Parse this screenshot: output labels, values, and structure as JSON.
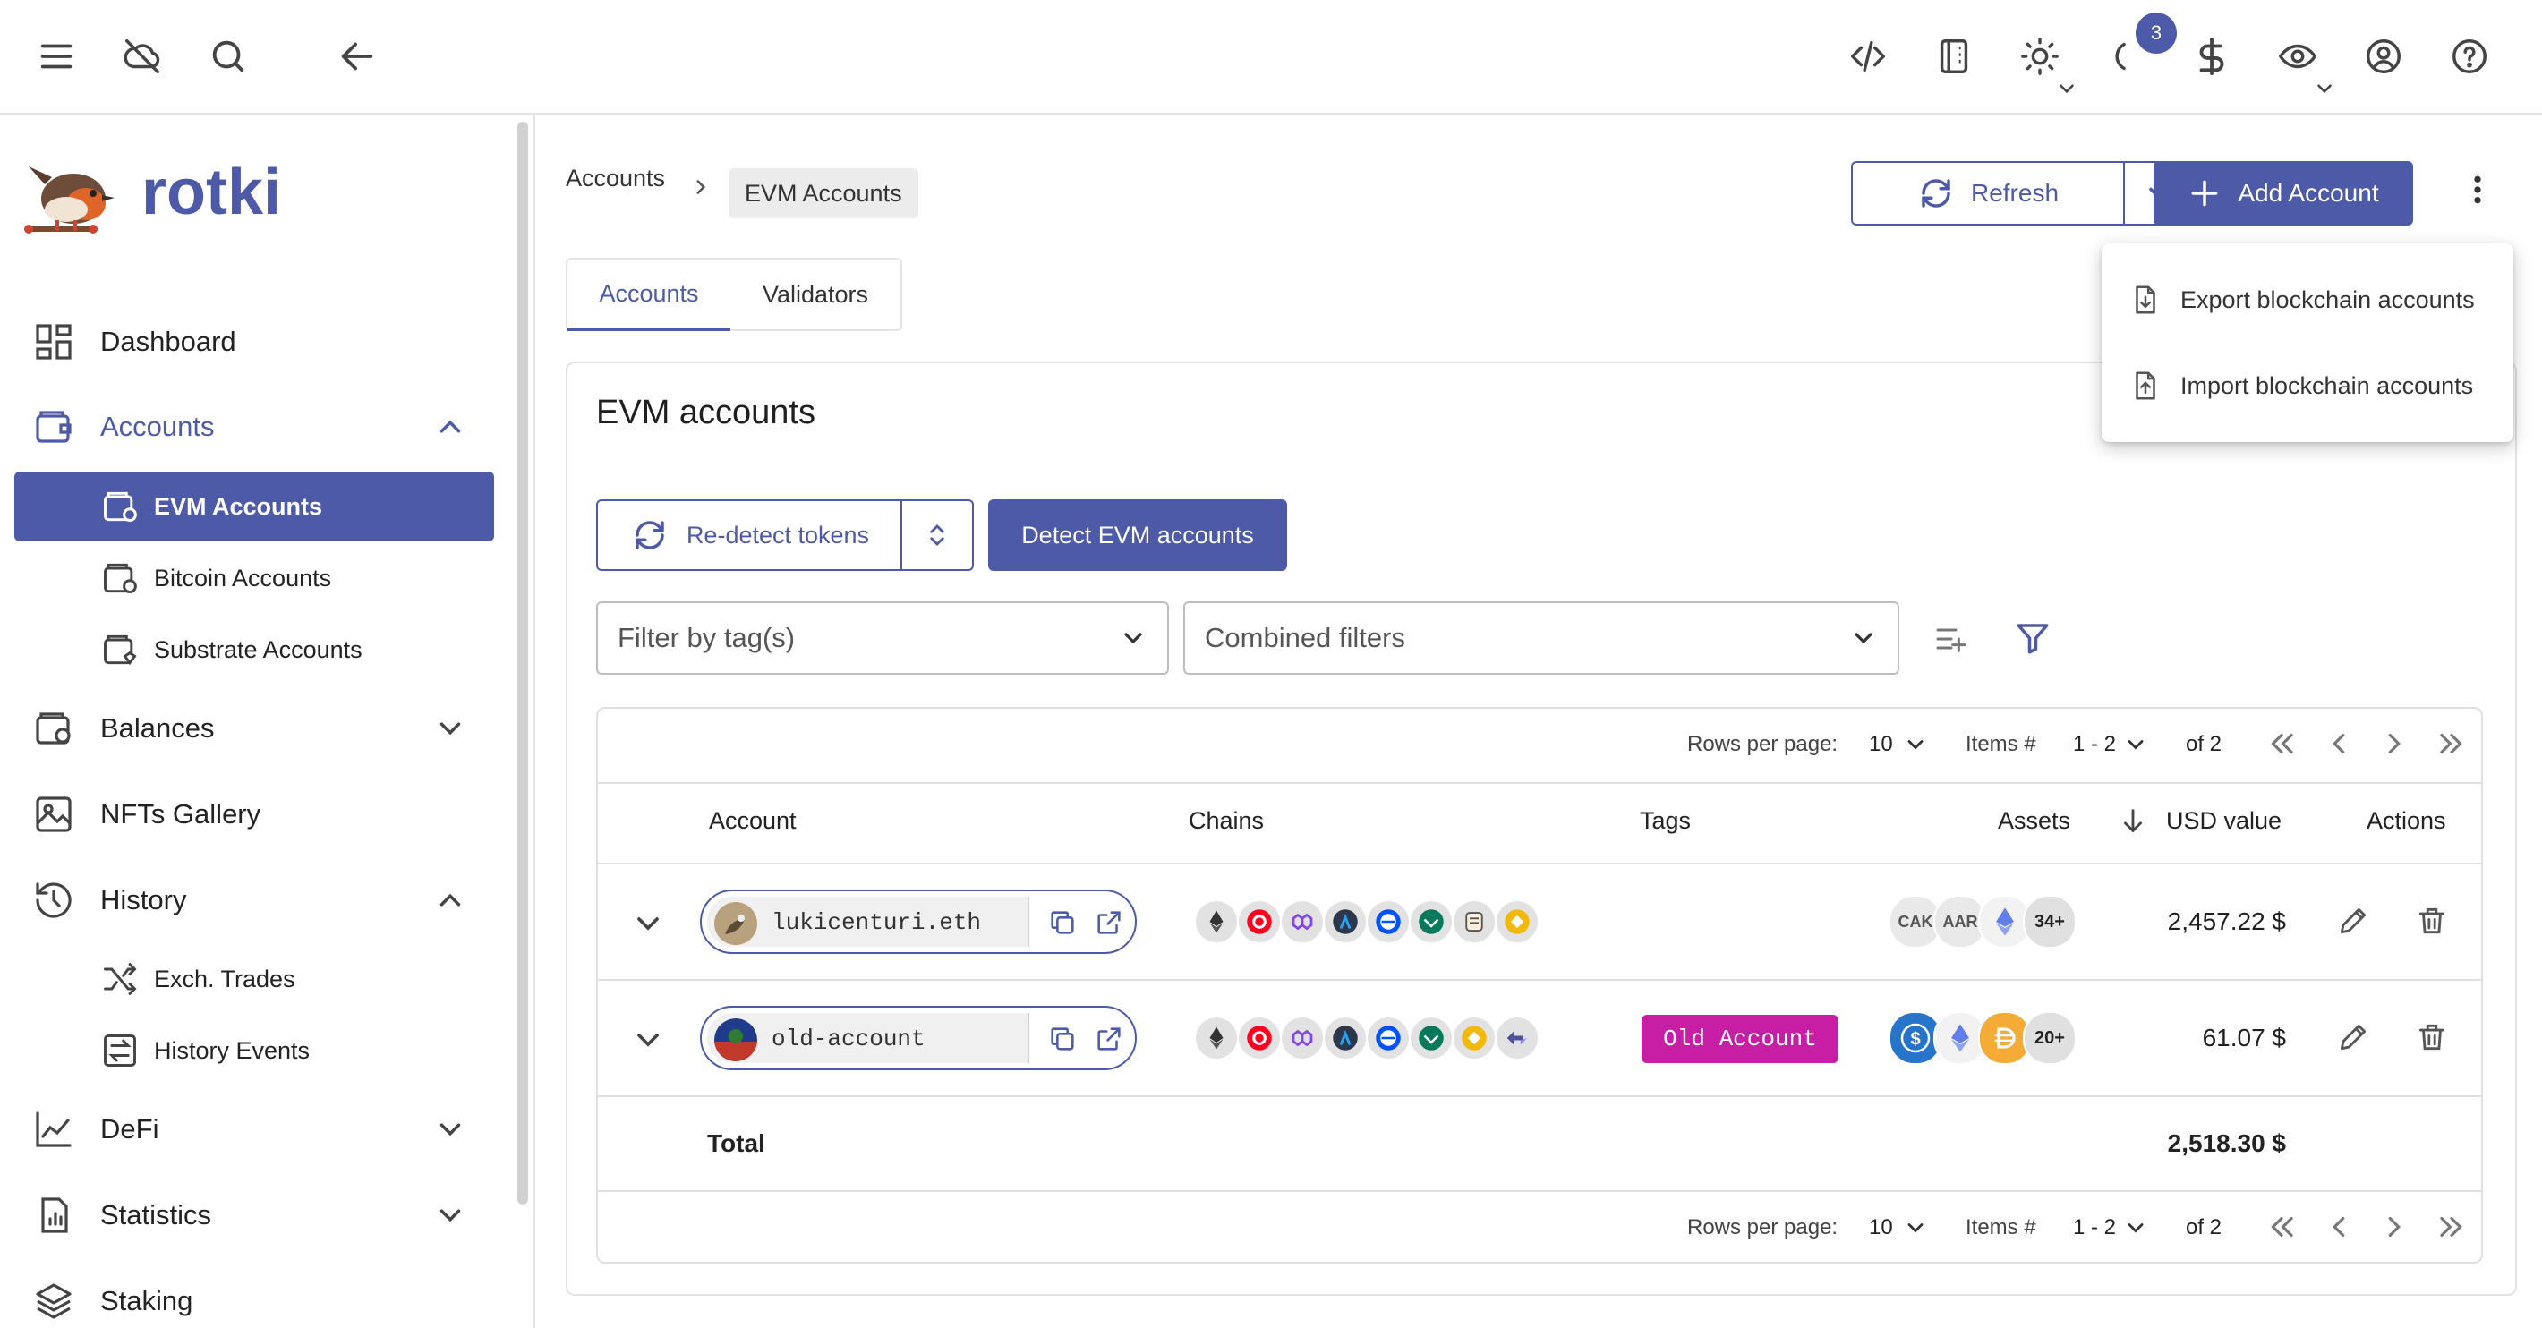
{
  "app": {
    "name": "rotki",
    "accent": "#4d5aa7"
  },
  "topbar": {
    "icons": [
      "menu-icon",
      "cloud-off-icon",
      "search-icon",
      "back-arrow-icon",
      "code-icon",
      "notebook-icon",
      "sun-icon",
      "moon-icon",
      "dollar-icon",
      "eye-icon",
      "account-circle-icon",
      "help-icon"
    ],
    "notification_count": "3"
  },
  "sidebar": {
    "items": [
      {
        "label": "Dashboard",
        "icon": "dashboard-icon"
      },
      {
        "label": "Accounts",
        "icon": "wallet-icon"
      },
      {
        "label": "EVM Accounts",
        "icon": "evm-wallet-icon"
      },
      {
        "label": "Bitcoin Accounts",
        "icon": "bitcoin-wallet-icon"
      },
      {
        "label": "Substrate Accounts",
        "icon": "substrate-wallet-icon"
      },
      {
        "label": "Balances",
        "icon": "balances-icon"
      },
      {
        "label": "NFTs Gallery",
        "icon": "image-icon"
      },
      {
        "label": "History",
        "icon": "history-icon"
      },
      {
        "label": "Exch. Trades",
        "icon": "shuffle-icon"
      },
      {
        "label": "History Events",
        "icon": "transfer-icon"
      },
      {
        "label": "DeFi",
        "icon": "chart-line-icon"
      },
      {
        "label": "Statistics",
        "icon": "statistics-icon"
      },
      {
        "label": "Staking",
        "icon": "stack-icon"
      }
    ]
  },
  "breadcrumb": {
    "root": "Accounts",
    "current": "EVM Accounts"
  },
  "header_actions": {
    "refresh": "Refresh",
    "add_account": "Add Account"
  },
  "menu": {
    "export": "Export blockchain accounts",
    "import": "Import blockchain accounts"
  },
  "tabs": [
    "Accounts",
    "Validators"
  ],
  "card": {
    "title": "EVM accounts",
    "redetect": "Re-detect tokens",
    "detect": "Detect EVM accounts",
    "filter_tags_placeholder": "Filter by tag(s)",
    "combined_filters_placeholder": "Combined filters"
  },
  "pagination": {
    "rows_per_page_label": "Rows per page:",
    "rows_per_page": "10",
    "items_label": "Items #",
    "items_range": "1 - 2",
    "of_total": "of 2"
  },
  "table": {
    "columns": {
      "account": "Account",
      "chains": "Chains",
      "tags": "Tags",
      "assets": "Assets",
      "usd": "USD value",
      "actions": "Actions"
    },
    "rows": [
      {
        "name": "lukicenturi.eth",
        "tag": "",
        "assets": [
          "CAK",
          "AAR",
          "ETH"
        ],
        "assets_more": "34+",
        "usd": "2,457.22 $"
      },
      {
        "name": "old-account",
        "tag": "Old Account",
        "assets": [
          "USDC",
          "ETH",
          "DAI"
        ],
        "assets_more": "20+",
        "usd": "61.07 $"
      }
    ],
    "total_label": "Total",
    "total_value": "2,518.30 $"
  }
}
